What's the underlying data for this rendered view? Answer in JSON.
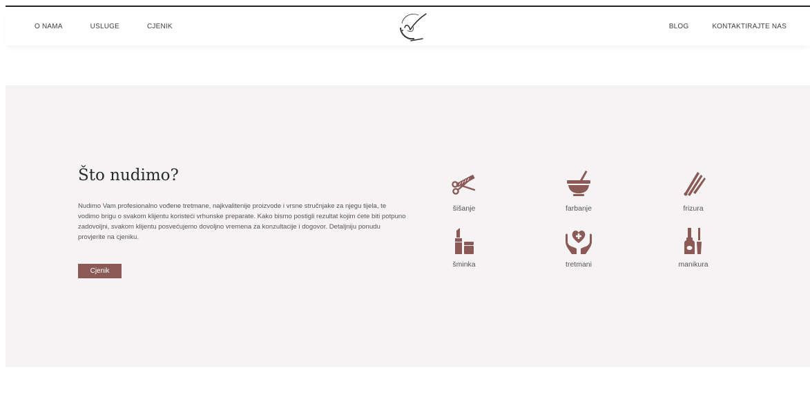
{
  "nav": {
    "left": [
      {
        "label": "O NAMA"
      },
      {
        "label": "USLUGE"
      },
      {
        "label": "CJENIK"
      }
    ],
    "right": [
      {
        "label": "BLOG"
      },
      {
        "label": "KONTAKTIRAJTE NAS"
      }
    ]
  },
  "logo": {
    "icon": "signature-logo-icon"
  },
  "section": {
    "title": "Što nudimo?",
    "description": "Nudimo Vam profesionalno vođene tretmane, najkvalitenije proizvode i vrsne stručnjake za njegu tijela, te vodimo brigu o svakom klijentu koristeći vrhunske preparate. Kako bismo postigli rezultat kojim ćete biti potpuno zadovoljni, svakom klijentu posvećujemo dovoljno vremena za konzultacije i dogovor. Detaljniju ponudu provjerite na cjeniku.",
    "cta_label": "Cjenik"
  },
  "services": [
    {
      "label": "šišanje",
      "icon": "scissors-comb-icon"
    },
    {
      "label": "farbanje",
      "icon": "bowl-brush-icon"
    },
    {
      "label": "frizura",
      "icon": "hair-tools-icon"
    },
    {
      "label": "šminka",
      "icon": "lipstick-icon"
    },
    {
      "label": "tretmani",
      "icon": "hands-heart-icon"
    },
    {
      "label": "manikura",
      "icon": "nail-polish-icon"
    }
  ],
  "colors": {
    "accent": "#8b5a56",
    "section_bg": "#f5f3f3"
  }
}
